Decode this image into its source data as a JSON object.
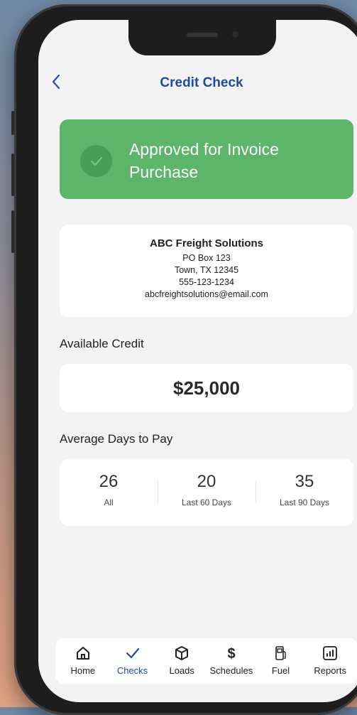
{
  "header": {
    "back_icon": "chevron-left-icon",
    "title": "Credit Check"
  },
  "status": {
    "text": "Approved for Invoice Purchase",
    "icon": "check-circle-icon",
    "color": "#5db56a"
  },
  "company": {
    "name": "ABC Freight Solutions",
    "address1": "PO Box 123",
    "address2": "Town, TX 12345",
    "phone": "555-123-1234",
    "email": "abcfreightsolutions@email.com"
  },
  "credit": {
    "label": "Available Credit",
    "amount": "$25,000"
  },
  "days_to_pay": {
    "label": "Average Days to Pay",
    "stats": [
      {
        "value": "26",
        "label": "All"
      },
      {
        "value": "20",
        "label": "Last 60 Days"
      },
      {
        "value": "35",
        "label": "Last 90 Days"
      }
    ]
  },
  "tabs": [
    {
      "label": "Home",
      "icon": "home-icon"
    },
    {
      "label": "Checks",
      "icon": "check-icon",
      "active": true
    },
    {
      "label": "Loads",
      "icon": "box-icon"
    },
    {
      "label": "Schedules",
      "icon": "dollar-icon"
    },
    {
      "label": "Fuel",
      "icon": "fuel-pump-icon"
    },
    {
      "label": "Reports",
      "icon": "bar-chart-icon"
    }
  ],
  "colors": {
    "accent": "#1f4aa0",
    "success": "#5db56a",
    "background": "#f3f3f3"
  }
}
